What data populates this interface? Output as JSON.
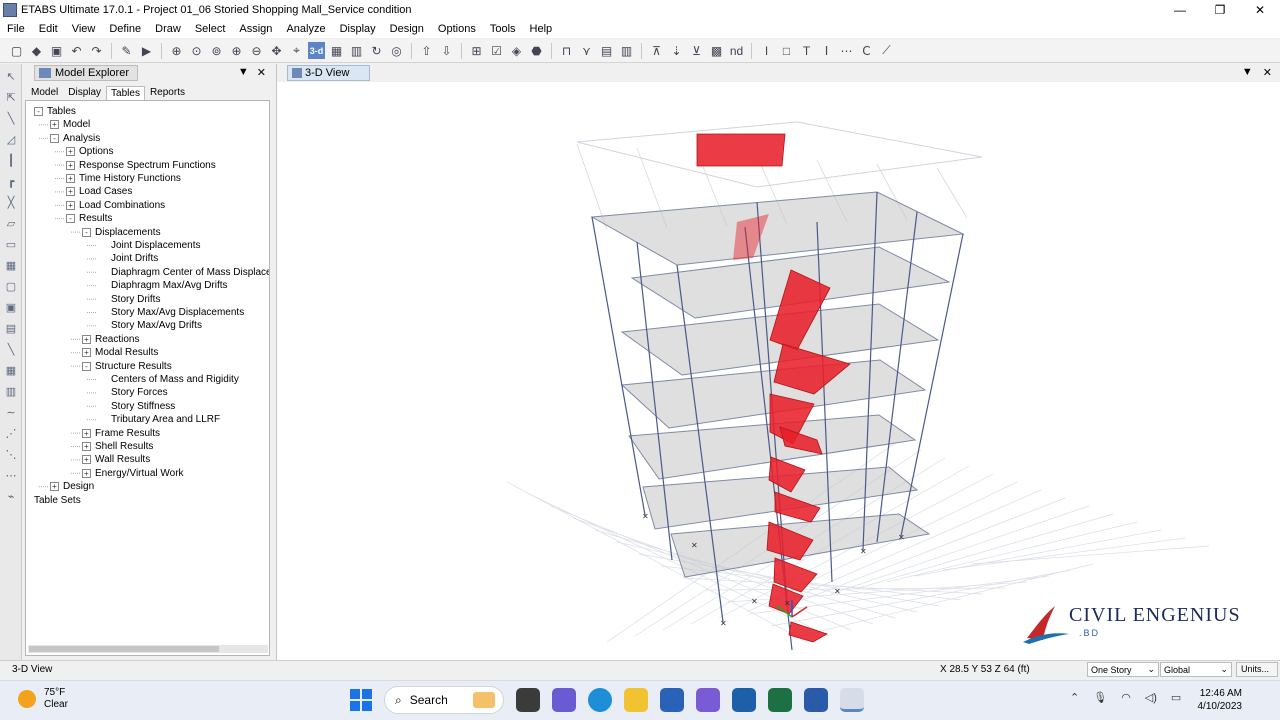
{
  "window": {
    "title": "ETABS Ultimate 17.0.1 - Project 01_06 Storied Shopping Mall_Service condition"
  },
  "menu": [
    "File",
    "Edit",
    "View",
    "Define",
    "Draw",
    "Select",
    "Assign",
    "Analyze",
    "Display",
    "Design",
    "Options",
    "Tools",
    "Help"
  ],
  "toolbar": {
    "view_3d_label": "3-d",
    "nd_label": "nd"
  },
  "explorer": {
    "title": "Model Explorer",
    "tabs": [
      "Model",
      "Display",
      "Tables",
      "Reports"
    ],
    "selected_tab": "Tables",
    "tree": [
      {
        "label": "Tables",
        "level": 0,
        "exp": "-"
      },
      {
        "label": "Model",
        "level": 1,
        "exp": "+"
      },
      {
        "label": "Analysis",
        "level": 1,
        "exp": "-"
      },
      {
        "label": "Options",
        "level": 2,
        "exp": "+"
      },
      {
        "label": "Response Spectrum Functions",
        "level": 2,
        "exp": "+"
      },
      {
        "label": "Time History Functions",
        "level": 2,
        "exp": "+"
      },
      {
        "label": "Load Cases",
        "level": 2,
        "exp": "+"
      },
      {
        "label": "Load Combinations",
        "level": 2,
        "exp": "+"
      },
      {
        "label": "Results",
        "level": 2,
        "exp": "-"
      },
      {
        "label": "Displacements",
        "level": 3,
        "exp": "-"
      },
      {
        "label": "Joint Displacements",
        "level": 4,
        "exp": ""
      },
      {
        "label": "Joint Drifts",
        "level": 4,
        "exp": ""
      },
      {
        "label": "Diaphragm Center of Mass Displacemen",
        "level": 4,
        "exp": ""
      },
      {
        "label": "Diaphragm Max/Avg Drifts",
        "level": 4,
        "exp": ""
      },
      {
        "label": "Story Drifts",
        "level": 4,
        "exp": ""
      },
      {
        "label": "Story Max/Avg Displacements",
        "level": 4,
        "exp": ""
      },
      {
        "label": "Story Max/Avg Drifts",
        "level": 4,
        "exp": ""
      },
      {
        "label": "Reactions",
        "level": 3,
        "exp": "+"
      },
      {
        "label": "Modal Results",
        "level": 3,
        "exp": "+"
      },
      {
        "label": "Structure Results",
        "level": 3,
        "exp": "-"
      },
      {
        "label": "Centers of Mass and Rigidity",
        "level": 4,
        "exp": ""
      },
      {
        "label": "Story Forces",
        "level": 4,
        "exp": ""
      },
      {
        "label": "Story Stiffness",
        "level": 4,
        "exp": ""
      },
      {
        "label": "Tributary Area and LLRF",
        "level": 4,
        "exp": ""
      },
      {
        "label": "Frame Results",
        "level": 3,
        "exp": "+"
      },
      {
        "label": "Shell Results",
        "level": 3,
        "exp": "+"
      },
      {
        "label": "Wall Results",
        "level": 3,
        "exp": "+"
      },
      {
        "label": "Energy/Virtual Work",
        "level": 3,
        "exp": "+"
      },
      {
        "label": "Design",
        "level": 1,
        "exp": "+"
      },
      {
        "label": "Table Sets",
        "level": 0,
        "exp": ""
      }
    ]
  },
  "view": {
    "tab_label": "3-D View"
  },
  "watermark": {
    "name": "CIVIL ENGENIUS",
    "sub": ".BD"
  },
  "status": {
    "view_name": "3-D View",
    "coords": "X 28.5  Y 53  Z 64 (ft)",
    "story_option": "One Story",
    "coord_system": "Global",
    "units_label": "Units..."
  },
  "taskbar": {
    "temperature": "75°F",
    "condition": "Clear",
    "search_label": "Search",
    "time": "12:46 AM",
    "date": "4/10/2023"
  },
  "colors": {
    "accent": "#5a86c8",
    "wall_red": "#e8202a",
    "slab_gray": "#c4c4c4",
    "frame_blue": "#4a5a8a"
  }
}
